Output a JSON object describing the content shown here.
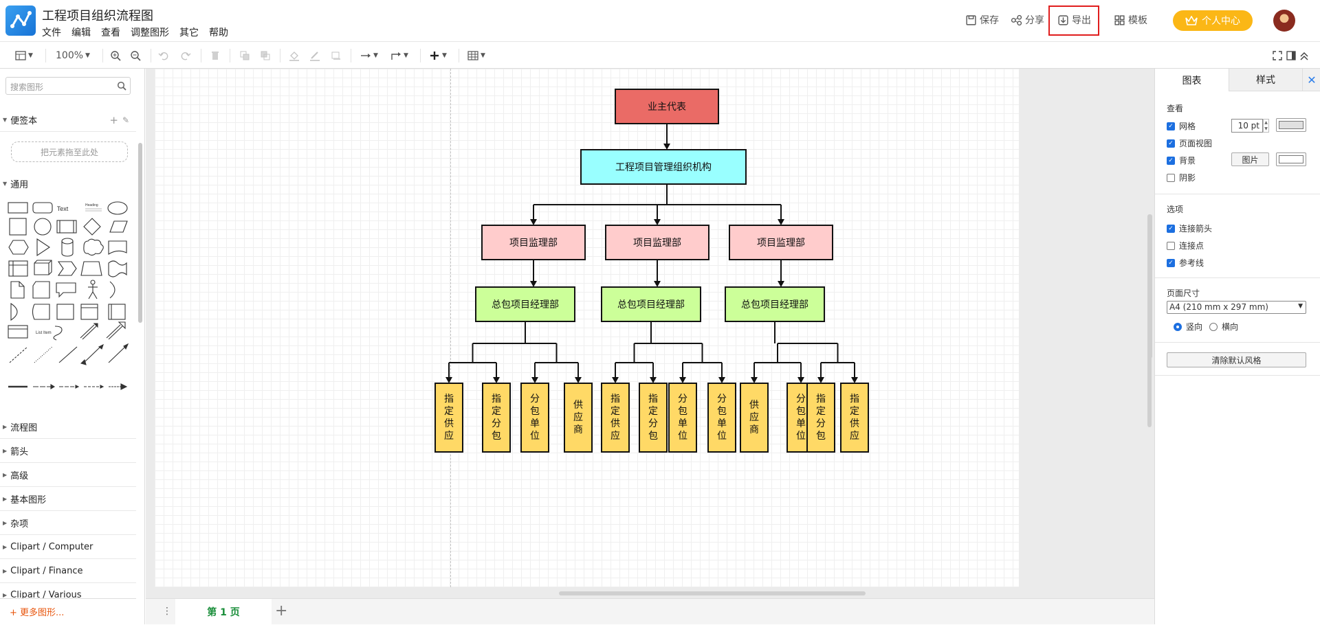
{
  "header": {
    "title": "工程项目组织流程图",
    "menus": [
      "文件",
      "编辑",
      "查看",
      "调整图形",
      "其它",
      "帮助"
    ],
    "save_label": "保存",
    "share_label": "分享",
    "export_label": "导出",
    "template_label": "模板",
    "vip_label": "个人中心",
    "accent_color": "#fbb716",
    "highlight_color": "#e01c1c"
  },
  "toolbar": {
    "zoom": "100%",
    "icons": [
      "layout-icon",
      "zoom-in-icon",
      "zoom-out-icon",
      "undo-icon",
      "redo-icon",
      "delete-icon",
      "to-front-icon",
      "to-back-icon",
      "fill-color-icon",
      "line-color-icon",
      "shadow-icon",
      "connection-icon",
      "waypoint-icon",
      "insert-icon",
      "table-icon",
      "fullscreen-icon",
      "format-panel-icon",
      "collapse-icon"
    ]
  },
  "left_panel": {
    "search_placeholder": "搜索图形",
    "scratchpad_label": "便签本",
    "scratchpad_drop": "把元素拖至此处",
    "general_label": "通用",
    "text_shape_label": "Text",
    "heading_shape_label": "Heading",
    "list_shape_label": "List Item",
    "sections": [
      "流程图",
      "箭头",
      "高级",
      "基本图形",
      "杂项",
      "Clipart / Computer",
      "Clipart / Finance",
      "Clipart / Various"
    ],
    "more_shapes": "+ 更多图形..."
  },
  "diagram": {
    "root": {
      "label": "业主代表",
      "color": "#ea6b66"
    },
    "org": {
      "label": "工程项目管理组织机构",
      "color": "#99ffff"
    },
    "supervisors": {
      "label": "项目监理部",
      "color": "#ffcccc",
      "count": 3
    },
    "managers": {
      "label": "总包项目经理部",
      "color": "#ccff99",
      "count": 3
    },
    "units": {
      "color": "#ffd966",
      "labels": [
        "指定供应",
        "指定分包",
        "分包单位",
        "供应商",
        "指定供应",
        "指定分包",
        "分包单位",
        "分包单位",
        "供应商",
        "分包单位",
        "指定分包",
        "指定供应"
      ]
    }
  },
  "page_bar": {
    "page_label": "第 1 页",
    "add_label": "+"
  },
  "right_panel": {
    "tab_diagram": "图表",
    "tab_style": "样式",
    "close": "✕",
    "view_title": "查看",
    "grid_label": "网格",
    "grid_size": "10 pt",
    "page_view_label": "页面视图",
    "background_label": "背景",
    "image_button": "图片",
    "shadow_label": "阴影",
    "options_title": "选项",
    "connection_arrows_label": "连接箭头",
    "connection_points_label": "连接点",
    "guides_label": "参考线",
    "page_size_title": "页面尺寸",
    "page_size_value": "A4 (210 mm x 297 mm)",
    "portrait_label": "竖向",
    "landscape_label": "横向",
    "clear_style_button": "清除默认风格",
    "checked": {
      "grid": true,
      "page_view": true,
      "background": true,
      "shadow": false,
      "connection_arrows": true,
      "connection_points": false,
      "guides": true
    }
  }
}
